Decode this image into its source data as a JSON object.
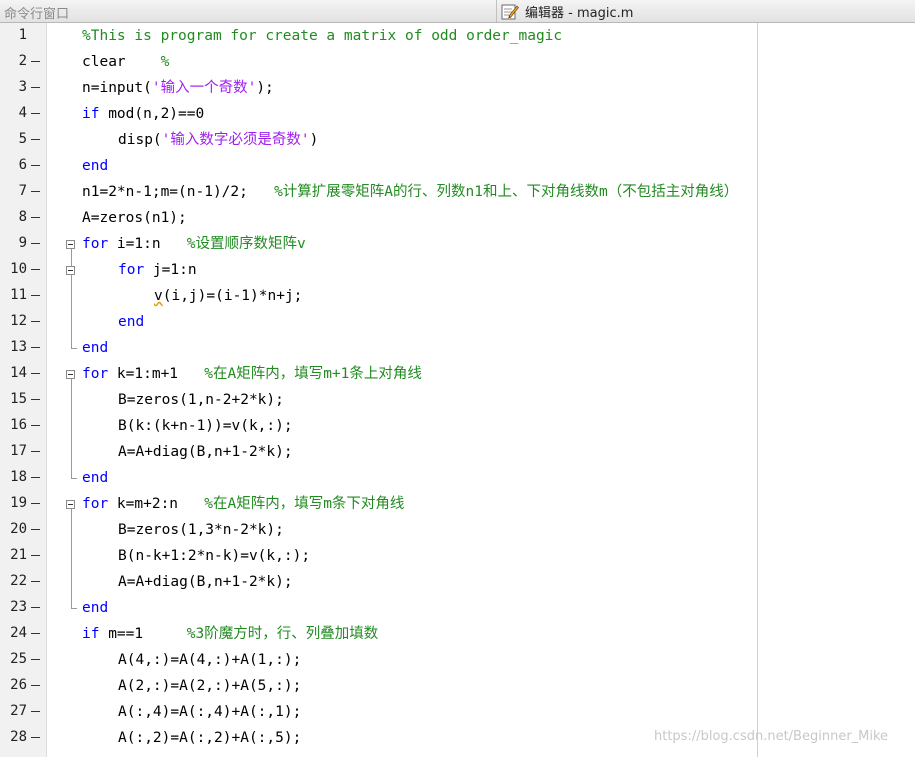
{
  "titlebar": {
    "command_window_title": "命令行窗口",
    "editor_title": "编辑器 - magic.m"
  },
  "watermark": "https://blog.csdn.net/Beginner_Mike",
  "lines": [
    {
      "n": "1",
      "dash": false,
      "indent": 0,
      "parts": [
        {
          "t": "%This is program for create a matrix of odd order_magic",
          "c": "cm"
        }
      ]
    },
    {
      "n": "2",
      "dash": true,
      "indent": 0,
      "parts": [
        {
          "t": "clear    ",
          "c": ""
        },
        {
          "t": "%",
          "c": "cm"
        }
      ]
    },
    {
      "n": "3",
      "dash": true,
      "indent": 0,
      "parts": [
        {
          "t": "n=input(",
          "c": ""
        },
        {
          "t": "'输入一个奇数'",
          "c": "st"
        },
        {
          "t": ");",
          "c": ""
        }
      ]
    },
    {
      "n": "4",
      "dash": true,
      "indent": 0,
      "parts": [
        {
          "t": "if",
          "c": "kw"
        },
        {
          "t": " mod(n,2)==0",
          "c": ""
        }
      ]
    },
    {
      "n": "5",
      "dash": true,
      "indent": 1,
      "parts": [
        {
          "t": "disp(",
          "c": ""
        },
        {
          "t": "'输入数字必须是奇数'",
          "c": "st"
        },
        {
          "t": ")",
          "c": ""
        }
      ]
    },
    {
      "n": "6",
      "dash": true,
      "indent": 0,
      "parts": [
        {
          "t": "end",
          "c": "kw"
        }
      ]
    },
    {
      "n": "7",
      "dash": true,
      "indent": 0,
      "parts": [
        {
          "t": "n1=2*n-1;m=(n-1)/2;   ",
          "c": ""
        },
        {
          "t": "%计算扩展零矩阵A的行、列数n1和上、下对角线数m（不包括主对角线）",
          "c": "cm"
        }
      ]
    },
    {
      "n": "8",
      "dash": true,
      "indent": 0,
      "parts": [
        {
          "t": "A=zeros(n1);",
          "c": ""
        }
      ]
    },
    {
      "n": "9",
      "dash": true,
      "indent": 0,
      "parts": [
        {
          "t": "for",
          "c": "kw"
        },
        {
          "t": " i=1:n   ",
          "c": ""
        },
        {
          "t": "%设置顺序数矩阵v",
          "c": "cm"
        }
      ]
    },
    {
      "n": "10",
      "dash": true,
      "indent": 1,
      "parts": [
        {
          "t": "for",
          "c": "kw"
        },
        {
          "t": " j=1:n",
          "c": ""
        }
      ]
    },
    {
      "n": "11",
      "dash": true,
      "indent": 2,
      "parts": [
        {
          "t": "v",
          "c": "wavy"
        },
        {
          "t": "(i,j)=(i-1)*n+j;",
          "c": ""
        }
      ]
    },
    {
      "n": "12",
      "dash": true,
      "indent": 1,
      "parts": [
        {
          "t": "end",
          "c": "kw"
        }
      ]
    },
    {
      "n": "13",
      "dash": true,
      "indent": 0,
      "parts": [
        {
          "t": "end",
          "c": "kw"
        }
      ]
    },
    {
      "n": "14",
      "dash": true,
      "indent": 0,
      "parts": [
        {
          "t": "for",
          "c": "kw"
        },
        {
          "t": " k=1:m+1   ",
          "c": ""
        },
        {
          "t": "%在A矩阵内，填写m+1条上对角线",
          "c": "cm"
        }
      ]
    },
    {
      "n": "15",
      "dash": true,
      "indent": 1,
      "parts": [
        {
          "t": "B=zeros(1,n-2+2*k);",
          "c": ""
        }
      ]
    },
    {
      "n": "16",
      "dash": true,
      "indent": 1,
      "parts": [
        {
          "t": "B(k:(k+n-1))=v(k,:);",
          "c": ""
        }
      ]
    },
    {
      "n": "17",
      "dash": true,
      "indent": 1,
      "parts": [
        {
          "t": "A=A+diag(B,n+1-2*k);",
          "c": ""
        }
      ]
    },
    {
      "n": "18",
      "dash": true,
      "indent": 0,
      "parts": [
        {
          "t": "end",
          "c": "kw"
        }
      ]
    },
    {
      "n": "19",
      "dash": true,
      "indent": 0,
      "parts": [
        {
          "t": "for",
          "c": "kw"
        },
        {
          "t": " k=m+2:n   ",
          "c": ""
        },
        {
          "t": "%在A矩阵内，填写m条下对角线",
          "c": "cm"
        }
      ]
    },
    {
      "n": "20",
      "dash": true,
      "indent": 1,
      "parts": [
        {
          "t": "B=zeros(1,3*n-2*k);",
          "c": ""
        }
      ]
    },
    {
      "n": "21",
      "dash": true,
      "indent": 1,
      "parts": [
        {
          "t": "B(n-k+1:2*n-k)=v(k,:);",
          "c": ""
        }
      ]
    },
    {
      "n": "22",
      "dash": true,
      "indent": 1,
      "parts": [
        {
          "t": "A=A+diag(B,n+1-2*k);",
          "c": ""
        }
      ]
    },
    {
      "n": "23",
      "dash": true,
      "indent": 0,
      "parts": [
        {
          "t": "end",
          "c": "kw"
        }
      ]
    },
    {
      "n": "24",
      "dash": true,
      "indent": 0,
      "parts": [
        {
          "t": "if",
          "c": "kw"
        },
        {
          "t": " m==1     ",
          "c": ""
        },
        {
          "t": "%3阶魔方时，行、列叠加填数",
          "c": "cm"
        }
      ]
    },
    {
      "n": "25",
      "dash": true,
      "indent": 1,
      "parts": [
        {
          "t": "A(4,:)=A(4,:)+A(1,:);",
          "c": ""
        }
      ]
    },
    {
      "n": "26",
      "dash": true,
      "indent": 1,
      "parts": [
        {
          "t": "A(2,:)=A(2,:)+A(5,:);",
          "c": ""
        }
      ]
    },
    {
      "n": "27",
      "dash": true,
      "indent": 1,
      "parts": [
        {
          "t": "A(:,4)=A(:,4)+A(:,1);",
          "c": ""
        }
      ]
    },
    {
      "n": "28",
      "dash": true,
      "indent": 1,
      "parts": [
        {
          "t": "A(:,2)=A(:,2)+A(:,5);",
          "c": ""
        }
      ]
    }
  ]
}
